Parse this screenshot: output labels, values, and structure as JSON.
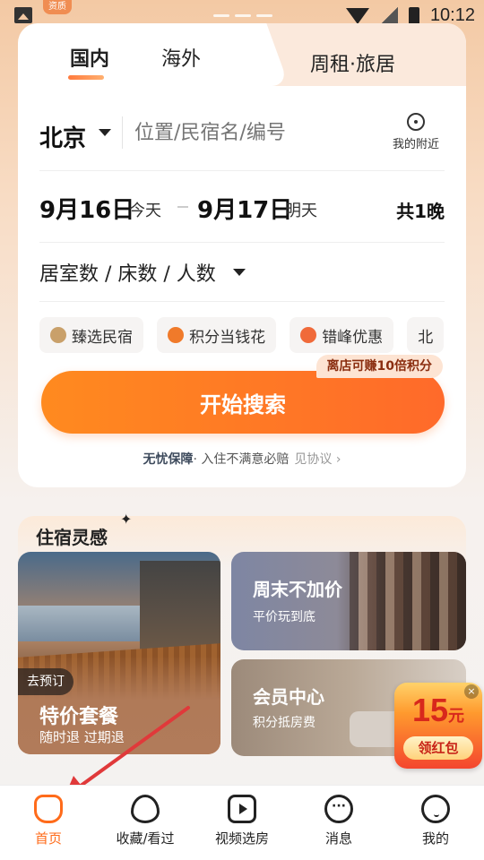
{
  "status_bar": {
    "tag": "资质",
    "time": "10:12"
  },
  "tabs": {
    "domestic": "国内",
    "overseas": "海外",
    "weekly": "周租·旅居"
  },
  "search": {
    "city": "北京",
    "placeholder": "位置/民宿名/编号",
    "nearby_label": "我的附近"
  },
  "dates": {
    "checkin": "9月16日",
    "checkin_sub": "今天",
    "checkout": "9月17日",
    "checkout_sub": "明天",
    "nights": "共1晚"
  },
  "rooms": {
    "label": "居室数 / 床数 / 人数"
  },
  "chips": [
    {
      "label": "臻选民宿",
      "color": "#c9a06a"
    },
    {
      "label": "积分当钱花",
      "color": "#f07a2a"
    },
    {
      "label": "错峰优惠",
      "color": "#f06a3a"
    },
    {
      "label": "北",
      "color": ""
    }
  ],
  "promo_badge": "离店可赚10倍积分",
  "search_button": "开始搜索",
  "guarantee": {
    "bold": "无忧保障",
    "text": "· 入住不满意必赔",
    "link": "见协议 ›"
  },
  "inspiration": {
    "title": "住宿灵感",
    "big_tile": {
      "tag": "去预订",
      "title": "特价套餐",
      "subtitle": "随时退 过期退"
    },
    "tile_weekend": {
      "title": "周末不加价",
      "subtitle": "平价玩到底"
    },
    "tile_member": {
      "title": "会员中心",
      "subtitle": "积分抵房费"
    }
  },
  "red_packet": {
    "amount": "15",
    "unit": "元",
    "button": "领红包",
    "close": "×"
  },
  "bottom_nav": [
    {
      "label": "首页",
      "icon": "home-icon",
      "active": true
    },
    {
      "label": "收藏/看过",
      "icon": "heart-icon",
      "active": false
    },
    {
      "label": "视频选房",
      "icon": "video-icon",
      "active": false
    },
    {
      "label": "消息",
      "icon": "message-icon",
      "active": false
    },
    {
      "label": "我的",
      "icon": "profile-icon",
      "active": false
    }
  ],
  "colors": {
    "accent": "#ff6b1a",
    "annotation_arrow": "#e0393a"
  }
}
